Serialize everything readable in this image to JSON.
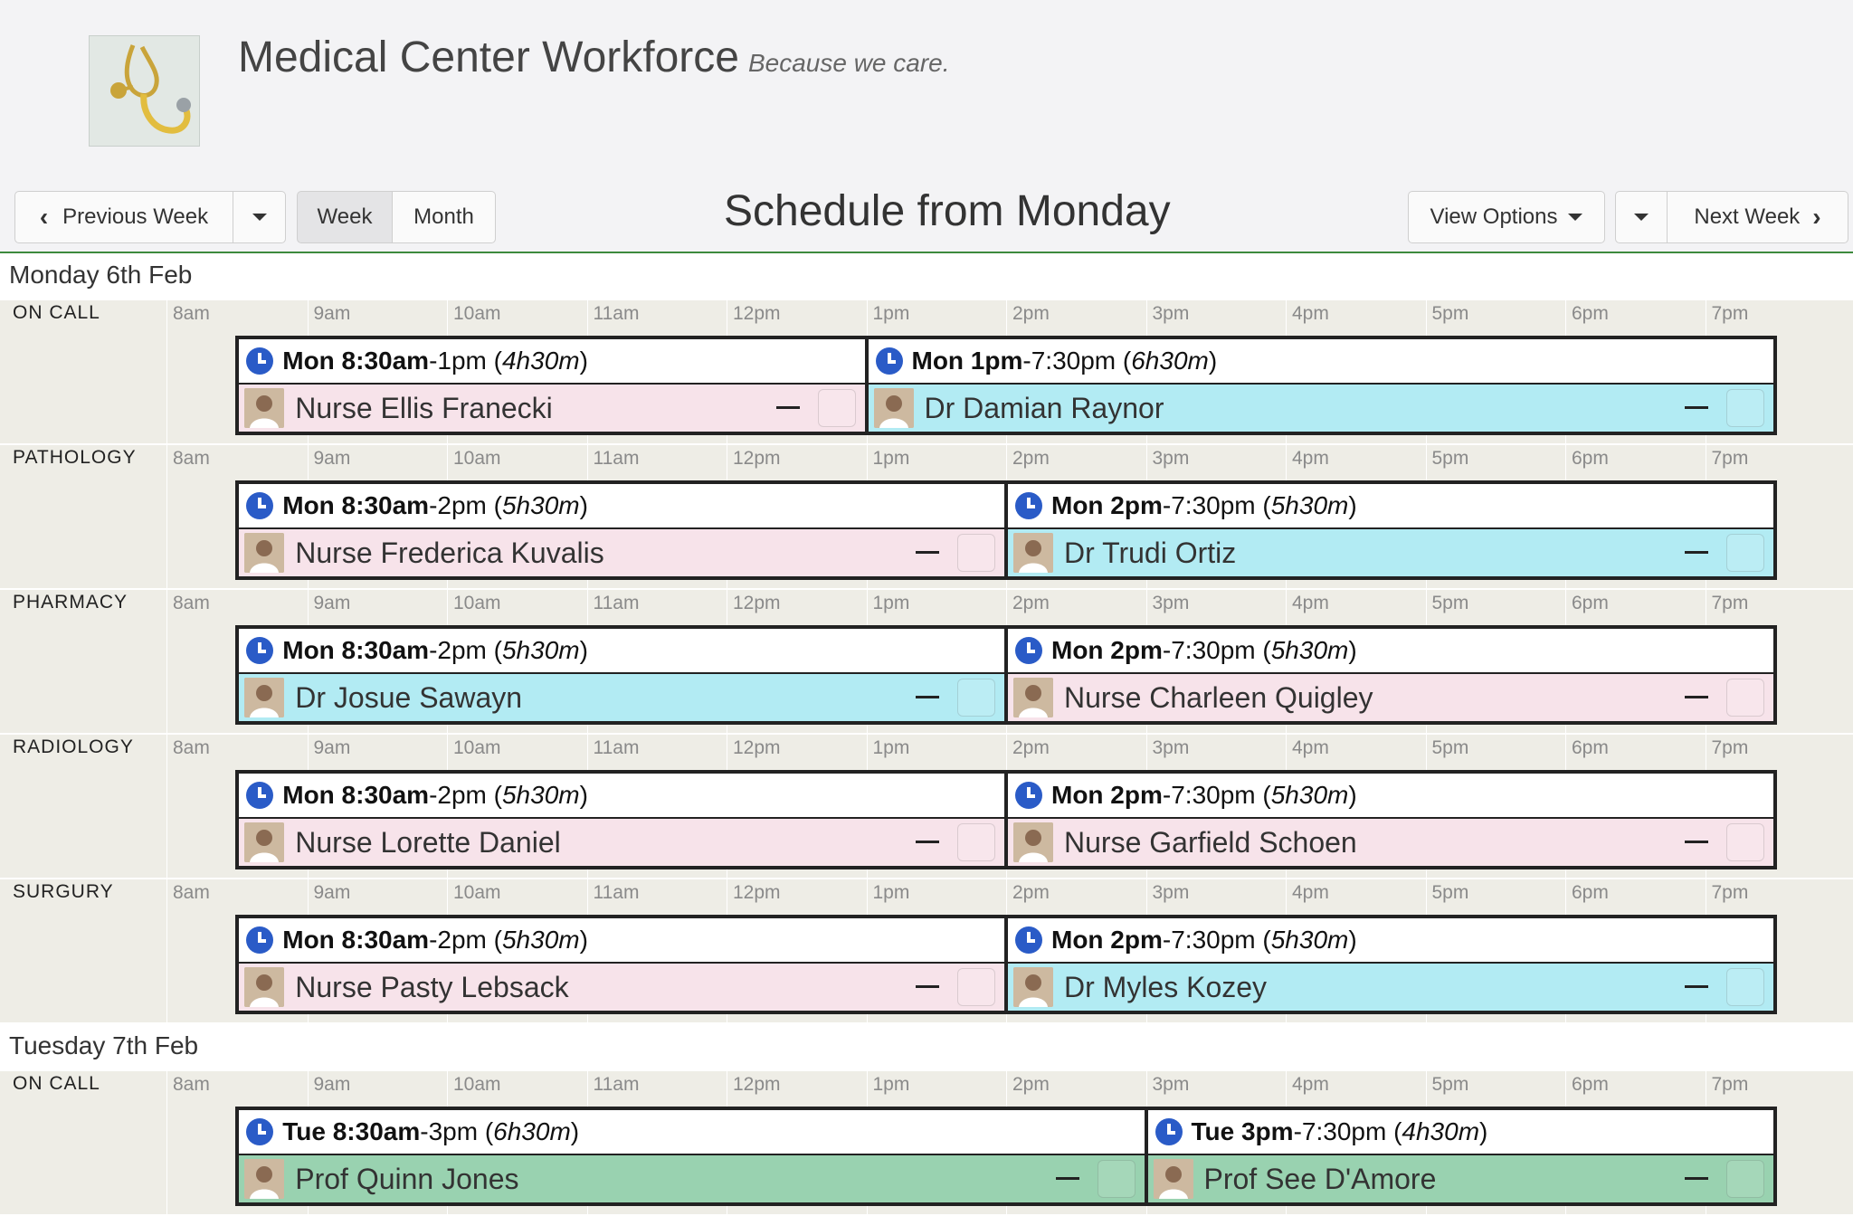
{
  "app": {
    "title": "Medical Center Workforce",
    "tagline": "Because we care."
  },
  "nav": {
    "previous_week": "Previous Week",
    "week": "Week",
    "month": "Month",
    "schedule_title": "Schedule from Monday",
    "view_options": "View Options",
    "next_week": "Next Week"
  },
  "hours": [
    "8am",
    "9am",
    "10am",
    "11am",
    "12pm",
    "1pm",
    "2pm",
    "3pm",
    "4pm",
    "5pm",
    "6pm",
    "7pm"
  ],
  "colors": {
    "accent_rule": "#3d8a3d",
    "clock": "#2a5bc7",
    "nurse": "#f7e3ea",
    "doctor": "#b2ebf3",
    "prof": "#99d2b0"
  },
  "days": [
    {
      "heading": "Monday 6th Feb",
      "departments": [
        {
          "name": "ON CALL",
          "shifts": [
            {
              "start": "Mon 8:30am",
              "end": "1pm",
              "duration": "4h30m",
              "person": "Nurse Ellis Franecki",
              "role": "nurse"
            },
            {
              "start": "Mon 1pm",
              "end": "7:30pm",
              "duration": "6h30m",
              "person": "Dr Damian Raynor",
              "role": "doctor"
            }
          ]
        },
        {
          "name": "PATHOLOGY",
          "shifts": [
            {
              "start": "Mon 8:30am",
              "end": "2pm",
              "duration": "5h30m",
              "person": "Nurse Frederica Kuvalis",
              "role": "nurse"
            },
            {
              "start": "Mon 2pm",
              "end": "7:30pm",
              "duration": "5h30m",
              "person": "Dr Trudi Ortiz",
              "role": "doctor"
            }
          ]
        },
        {
          "name": "PHARMACY",
          "shifts": [
            {
              "start": "Mon 8:30am",
              "end": "2pm",
              "duration": "5h30m",
              "person": "Dr Josue Sawayn",
              "role": "doctor"
            },
            {
              "start": "Mon 2pm",
              "end": "7:30pm",
              "duration": "5h30m",
              "person": "Nurse Charleen Quigley",
              "role": "nurse"
            }
          ]
        },
        {
          "name": "RADIOLOGY",
          "shifts": [
            {
              "start": "Mon 8:30am",
              "end": "2pm",
              "duration": "5h30m",
              "person": "Nurse Lorette Daniel",
              "role": "nurse"
            },
            {
              "start": "Mon 2pm",
              "end": "7:30pm",
              "duration": "5h30m",
              "person": "Nurse Garfield Schoen",
              "role": "nurse"
            }
          ]
        },
        {
          "name": "SURGURY",
          "shifts": [
            {
              "start": "Mon 8:30am",
              "end": "2pm",
              "duration": "5h30m",
              "person": "Nurse Pasty Lebsack",
              "role": "nurse"
            },
            {
              "start": "Mon 2pm",
              "end": "7:30pm",
              "duration": "5h30m",
              "person": "Dr Myles Kozey",
              "role": "doctor"
            }
          ]
        }
      ]
    },
    {
      "heading": "Tuesday 7th Feb",
      "departments": [
        {
          "name": "ON CALL",
          "shifts": [
            {
              "start": "Tue 8:30am",
              "end": "3pm",
              "duration": "6h30m",
              "person": "Prof Quinn Jones",
              "role": "prof"
            },
            {
              "start": "Tue 3pm",
              "end": "7:30pm",
              "duration": "4h30m",
              "person": "Prof See D'Amore",
              "role": "prof"
            }
          ]
        }
      ]
    }
  ]
}
